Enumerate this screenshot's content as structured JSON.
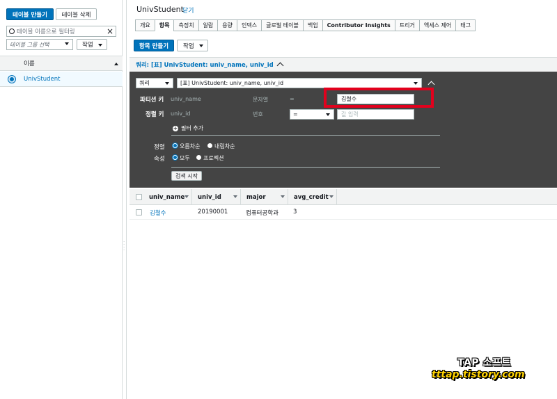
{
  "left": {
    "create_table": "테이블 만들기",
    "delete_table": "테이블 삭제",
    "filter_placeholder": "테이블 이름으로 필터링",
    "group_select": "테이블 그룹 선택",
    "action": "작업",
    "col_name": "이름",
    "tables": [
      "UnivStudent"
    ]
  },
  "header": {
    "title": "UnivStudent",
    "close": "닫기"
  },
  "tabs": [
    "개요",
    "항목",
    "측정치",
    "알람",
    "용량",
    "인덱스",
    "글로벌 테이블",
    "백업",
    "Contributor Insights",
    "트리거",
    "액세스 제어",
    "태그"
  ],
  "active_tab": "항목",
  "toolbar": {
    "create_item": "항목 만들기",
    "action": "작업"
  },
  "query": {
    "bar_label": "쿼리: [표] UnivStudent: univ_name, univ_id",
    "mode": "쿼리",
    "index": "[표] UnivStudent: univ_name, univ_id",
    "partition_label": "파티션 키",
    "partition_attr": "univ_name",
    "partition_type": "문자열",
    "partition_op": "=",
    "partition_value": "김철수",
    "sort_label": "정렬 키",
    "sort_attr": "univ_id",
    "sort_type": "번호",
    "sort_op": "=",
    "sort_placeholder": "값 입력",
    "add_filter": "필터 추가",
    "order_label": "정렬",
    "asc": "오름차순",
    "desc": "내림차순",
    "attr_label": "속성",
    "all": "모두",
    "projection": "프로젝션",
    "search": "검색 시작"
  },
  "results": {
    "columns": [
      "univ_name",
      "univ_id",
      "major",
      "avg_credit"
    ],
    "rows": [
      {
        "univ_name": "김철수",
        "univ_id": "20190001",
        "major": "컴퓨터공학과",
        "avg_credit": "3"
      }
    ]
  },
  "watermark": {
    "line1": "TAP 소프트",
    "line2": "tttap.tistory.com"
  }
}
